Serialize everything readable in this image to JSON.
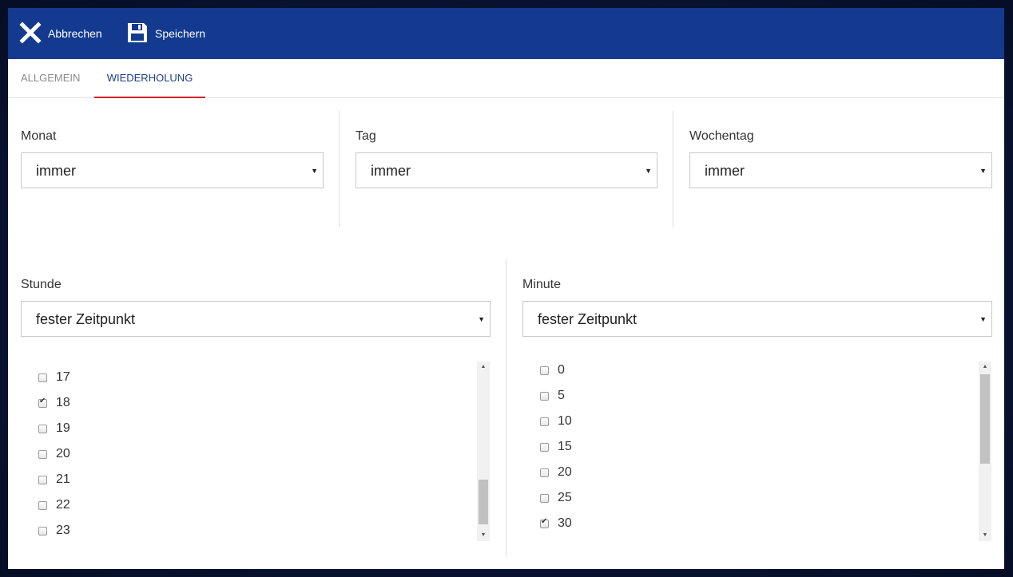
{
  "toolbar": {
    "cancel_label": "Abbrechen",
    "save_label": "Speichern",
    "cancel_icon": "close-icon",
    "save_icon": "floppy-disk-icon",
    "background": "#133a8e"
  },
  "tabs": [
    {
      "label": "ALLGEMEIN",
      "active": false
    },
    {
      "label": "WIEDERHOLUNG",
      "active": true
    }
  ],
  "fields": {
    "month": {
      "label": "Monat",
      "value": "immer"
    },
    "day": {
      "label": "Tag",
      "value": "immer"
    },
    "weekday": {
      "label": "Wochentag",
      "value": "immer"
    },
    "hour": {
      "label": "Stunde",
      "value": "fester Zeitpunkt"
    },
    "minute": {
      "label": "Minute",
      "value": "fester Zeitpunkt"
    }
  },
  "hour_list": {
    "items": [
      {
        "label": "17",
        "checked": false
      },
      {
        "label": "18",
        "checked": true
      },
      {
        "label": "19",
        "checked": false
      },
      {
        "label": "20",
        "checked": false
      },
      {
        "label": "21",
        "checked": false
      },
      {
        "label": "22",
        "checked": false
      },
      {
        "label": "23",
        "checked": false
      }
    ]
  },
  "minute_list": {
    "items": [
      {
        "label": "0",
        "checked": false
      },
      {
        "label": "5",
        "checked": false
      },
      {
        "label": "10",
        "checked": false
      },
      {
        "label": "15",
        "checked": false
      },
      {
        "label": "20",
        "checked": false
      },
      {
        "label": "25",
        "checked": false
      },
      {
        "label": "30",
        "checked": true
      }
    ]
  },
  "colors": {
    "accent": "#133a8e",
    "active_tab_underline": "#d0202e",
    "active_tab_text": "#1f3d86"
  }
}
